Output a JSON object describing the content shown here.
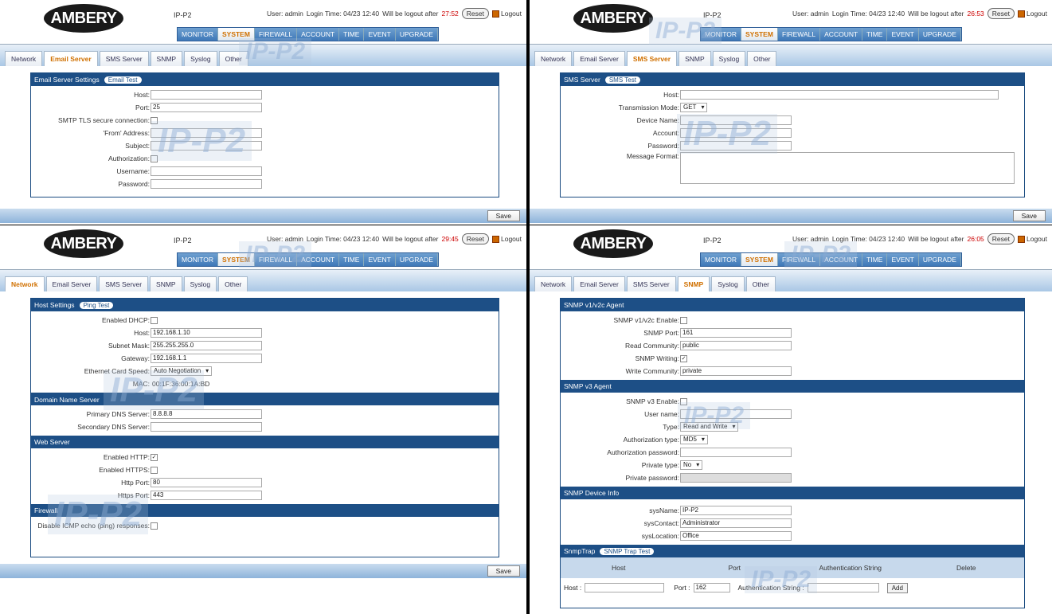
{
  "common": {
    "logo": "AMBERY",
    "device": "IP-P2",
    "watermark": "IP-P2",
    "user_label": "User: admin",
    "login_time": "Login Time: 04/23 12:40",
    "logout_prefix": "Will be logout after",
    "reset": "Reset",
    "logout": "Logout",
    "nav": [
      "MONITOR",
      "SYSTEM",
      "FIREWALL",
      "ACCOUNT",
      "TIME",
      "EVENT",
      "UPGRADE"
    ],
    "nav_active": "SYSTEM",
    "tabs": [
      "Network",
      "Email Server",
      "SMS Server",
      "SNMP",
      "Syslog",
      "Other"
    ],
    "save": "Save"
  },
  "panels": {
    "email": {
      "countdown": "27:52",
      "active_tab": "Email Server",
      "section": "Email Server Settings",
      "test_button": "Email Test",
      "fields": {
        "host": "Host:",
        "port": "Port:",
        "port_val": "25",
        "tls": "SMTP TLS secure connection:",
        "from": "'From' Address:",
        "subject": "Subject:",
        "auth": "Authorization:",
        "username": "Username:",
        "password": "Password:"
      }
    },
    "sms": {
      "countdown": "26:53",
      "active_tab": "SMS Server",
      "section": "SMS Server",
      "test_button": "SMS Test",
      "fields": {
        "host": "Host:",
        "mode": "Transmission Mode:",
        "mode_val": "GET",
        "device": "Device Name:",
        "account": "Account:",
        "password": "Password:",
        "format": "Message Format:"
      }
    },
    "network": {
      "countdown": "29:45",
      "active_tab": "Network",
      "host_section": "Host Settings",
      "test_button": "Ping Test",
      "dhcp": "Enabled DHCP:",
      "host": "Host:",
      "host_val": "192.168.1.10",
      "mask": "Subnet Mask:",
      "mask_val": "255.255.255.0",
      "gw": "Gateway:",
      "gw_val": "192.168.1.1",
      "speed": "Ethernet Card Speed:",
      "speed_val": "Auto Negotiation",
      "mac": "MAC:",
      "mac_val": "00:1F:36:00:1A:BD",
      "dns_section": "Domain Name Server",
      "pdns": "Primary DNS Server:",
      "pdns_val": "8.8.8.8",
      "sdns": "Secondary DNS Server:",
      "web_section": "Web Server",
      "http": "Enabled HTTP:",
      "http_checked": true,
      "https": "Enabled HTTPS:",
      "http_port": "Http Port:",
      "http_port_val": "80",
      "https_port": "Https Port:",
      "https_port_val": "443",
      "fw_section": "Firewall",
      "icmp": "Disable ICMP echo (ping) responses:"
    },
    "snmp": {
      "countdown": "26:05",
      "active_tab": "SNMP",
      "v2_section": "SNMP v1/v2c Agent",
      "v2_enable": "SNMP v1/v2c Enable:",
      "port": "SNMP Port:",
      "port_val": "161",
      "read": "Read Community:",
      "read_val": "public",
      "writing": "SNMP Writing:",
      "write": "Write Community:",
      "write_val": "private",
      "v3_section": "SNMP v3 Agent",
      "v3_enable": "SNMP v3 Enable:",
      "username": "User name:",
      "type": "Type:",
      "type_val": "Read and Write",
      "authtype": "Authorization type:",
      "authtype_val": "MD5",
      "authpw": "Authorization password:",
      "privtype": "Private type:",
      "privtype_val": "No",
      "privpw": "Private password:",
      "info_section": "SNMP Device Info",
      "sysname": "sysName:",
      "sysname_val": "IP-P2",
      "syscontact": "sysContact:",
      "syscontact_val": "Administrator",
      "sysloc": "sysLocation:",
      "sysloc_val": "Office",
      "trap_section": "SnmpTrap",
      "trap_test": "SNMP Trap Test",
      "trap_cols": [
        "Host",
        "Port",
        "Authentication String",
        "Delete"
      ],
      "trap_host": "Host :",
      "trap_port": "Port :",
      "trap_port_val": "162",
      "trap_auth": "Authentication String :",
      "add": "Add"
    }
  }
}
